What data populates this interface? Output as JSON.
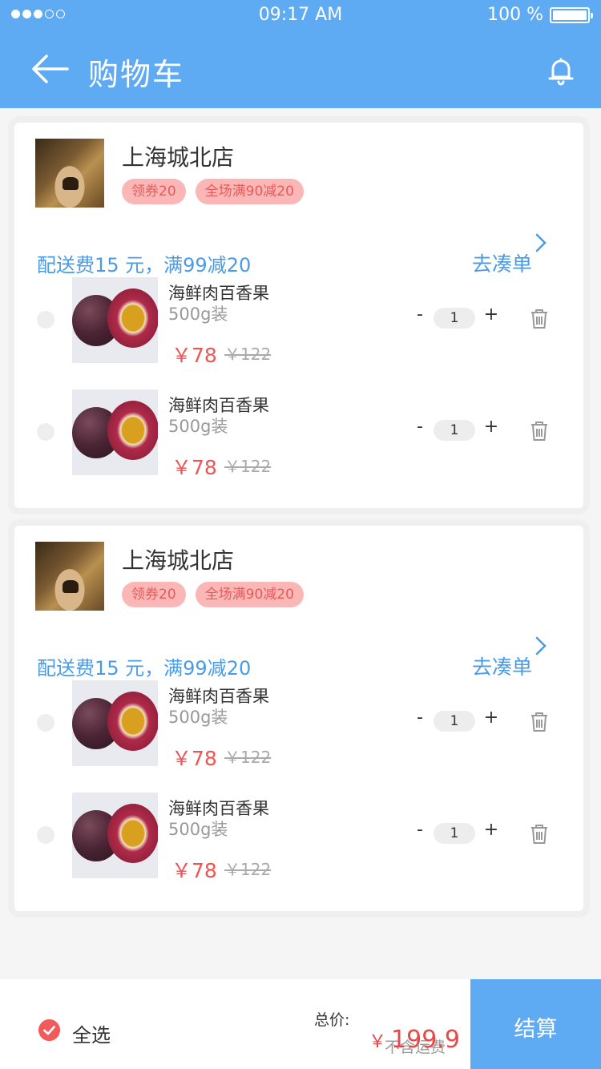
{
  "status_bar": {
    "time": "09:17 AM",
    "battery": "100 %"
  },
  "header": {
    "title": "购物车"
  },
  "stores": [
    {
      "name": "上海城北店",
      "coupons": [
        "领券20",
        "全场满90减20"
      ],
      "delivery": "配送费15 元，满99减20",
      "addon_label": "去凑单",
      "items": [
        {
          "name": "海鲜肉百香果",
          "spec": "500g装",
          "price": "￥78",
          "original_price": "￥122",
          "quantity": "1"
        },
        {
          "name": "海鲜肉百香果",
          "spec": "500g装",
          "price": "￥78",
          "original_price": "￥122",
          "quantity": "1"
        }
      ]
    },
    {
      "name": "上海城北店",
      "coupons": [
        "领券20",
        "全场满90减20"
      ],
      "delivery": "配送费15 元，满99减20",
      "addon_label": "去凑单",
      "items": [
        {
          "name": "海鲜肉百香果",
          "spec": "500g装",
          "price": "￥78",
          "original_price": "￥122",
          "quantity": "1"
        },
        {
          "name": "海鲜肉百香果",
          "spec": "500g装",
          "price": "￥78",
          "original_price": "￥122",
          "quantity": "1"
        }
      ]
    }
  ],
  "bottom": {
    "select_all": "全选",
    "total_label": "总价:",
    "currency": "￥",
    "total": "199.9",
    "shipping_note": "不含运费",
    "checkout": "结算"
  },
  "colors": {
    "primary": "#5eabf4",
    "accent": "#e84848",
    "badge_bg": "#fbb6b6"
  },
  "icons": [
    "back-arrow-icon",
    "bell-icon",
    "chevron-right-icon",
    "trash-icon",
    "check-icon"
  ],
  "controls": {
    "minus": "-",
    "plus": "+"
  }
}
